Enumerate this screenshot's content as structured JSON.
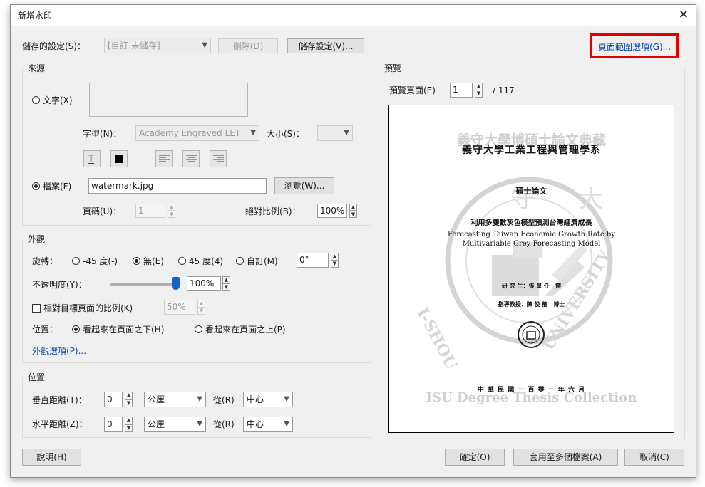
{
  "dialog": {
    "title": "新增水印",
    "close_glyph": "✕"
  },
  "settings_row": {
    "label": "儲存的設定(S)：",
    "preset_value": "[自訂-未儲存]",
    "delete_button": "刪除(D)",
    "save_button": "儲存設定(V)...",
    "page_range_link": "頁面範圍選項(G)..."
  },
  "source": {
    "group_label": "來源",
    "text_radio": "文字(X)",
    "font_label": "字型(N)：",
    "font_value": "Academy Engraved LET",
    "size_label": "大小(S)：",
    "file_radio": "檔案(F)",
    "file_value": "watermark.jpg",
    "browse_button": "瀏覽(W)...",
    "page_label": "頁碼(U)：",
    "page_value": "1",
    "scale_label": "絕對比例(B)：",
    "scale_value": "100%"
  },
  "appearance": {
    "group_label": "外觀",
    "rotation_label": "旋轉：",
    "rot_options": [
      "-45 度(-)",
      "無(E)",
      "45 度(4)",
      "自訂(M)"
    ],
    "rot_selected_index": 1,
    "rot_custom_value": "0°",
    "opacity_label": "不透明度(Y)：",
    "opacity_value": "100%",
    "opacity_fraction": 1.0,
    "relative_scale_label": "相對目標頁面的比例(K)",
    "relative_scale_value": "50%",
    "position_label": "位置：",
    "behind_label": "看起來在頁面之下(H)",
    "front_label": "看起來在頁面之上(P)",
    "options_link": "外觀選項(P)..."
  },
  "position": {
    "group_label": "位置",
    "vertical_label": "垂直距離(T)：",
    "vertical_value": "0",
    "vertical_unit": "公厘",
    "from_label_v": "從(R)",
    "vertical_from": "中心",
    "horizontal_label": "水平距離(Z)：",
    "horizontal_value": "0",
    "horizontal_unit": "公厘",
    "from_label_h": "從(R)",
    "horizontal_from": "中心"
  },
  "preview": {
    "group_label": "預覽",
    "page_label": "預覽頁面(E)",
    "page_value": "1",
    "total_pages": "/ 117",
    "doc": {
      "watermark_top": "義守大學博碩士論文典藏",
      "university_line": "義守大學工業工程與管理學系",
      "thesis_type": "碩士論文",
      "title_zh": "利用多變數灰色模型預測台灣經濟成長",
      "title_en_1": "Forecasting Taiwan Economic Growth Rate by",
      "title_en_2": "Multivariable Grey Forecasting Model",
      "student": "研 究 生：張 皇 任　撰",
      "advisor": "指導教授：陳 俊 龍　博士",
      "date_line": "中 華 民 國 一 百 零 一 年 六 月",
      "watermark_bottom": "ISU Degree Thesis Collection",
      "seal_top": "守　大",
      "seal_left": "I-SHOU",
      "seal_right": "UNIVERSITY"
    }
  },
  "footer": {
    "help_button": "說明(H)",
    "ok_button": "確定(O)",
    "apply_multiple_button": "套用至多個檔案(A)",
    "cancel_button": "取消(C)"
  }
}
